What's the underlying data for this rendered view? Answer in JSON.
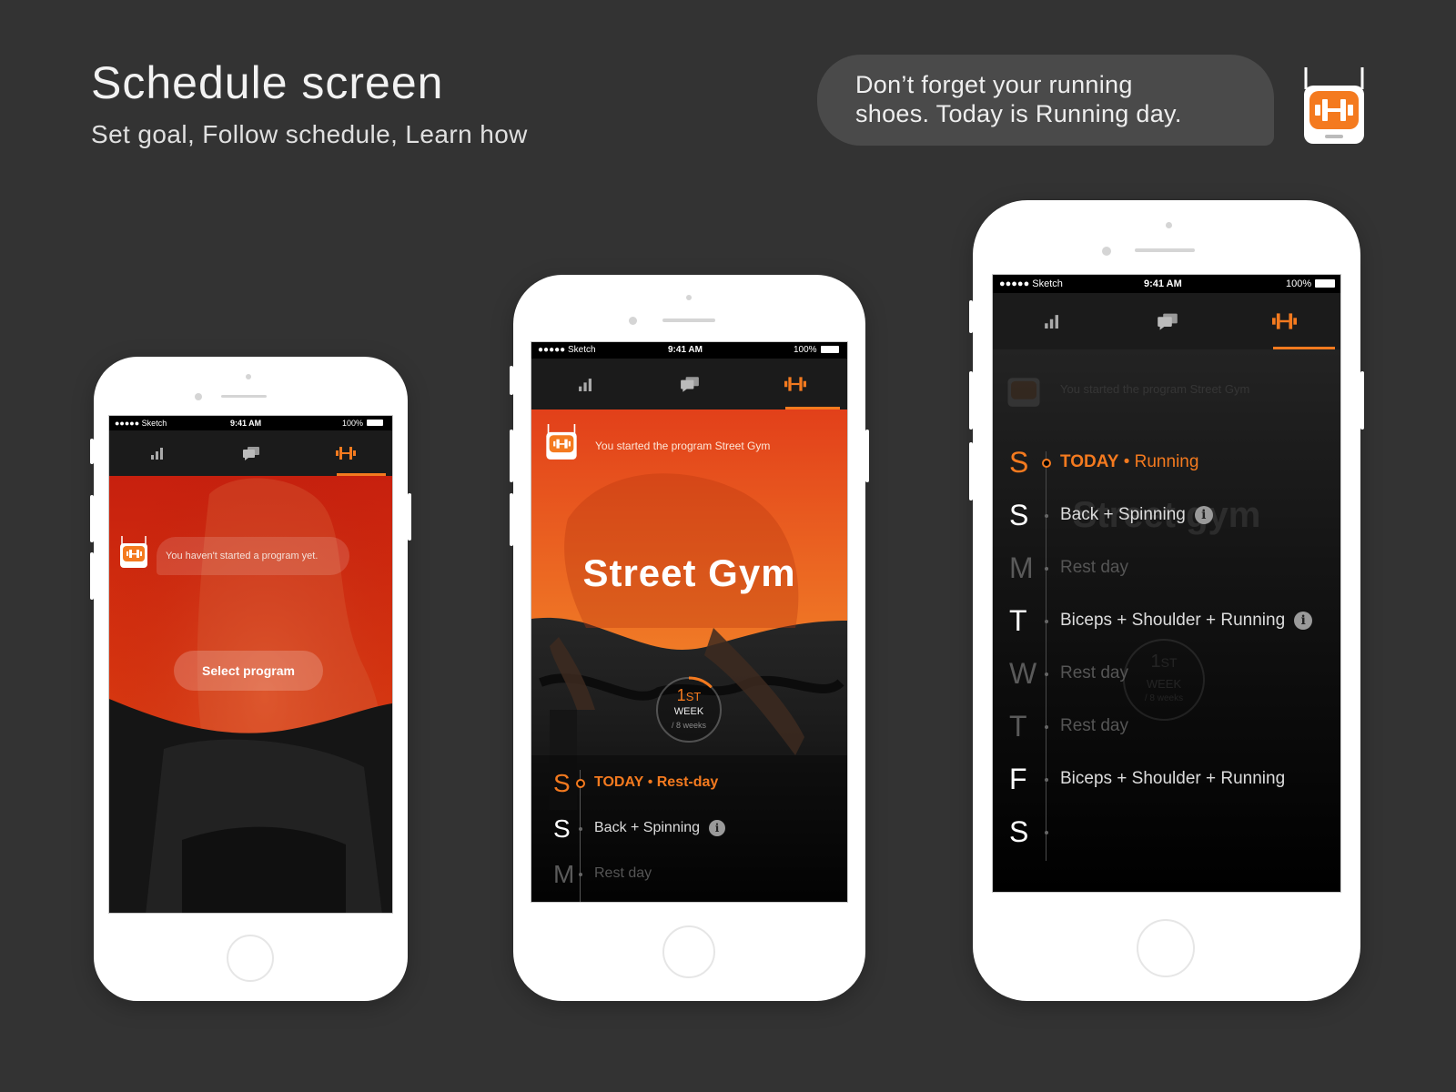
{
  "header": {
    "title": "Schedule screen",
    "subtitle": "Set goal, Follow schedule, Learn how"
  },
  "notification": {
    "line1": "Don’t forget your running",
    "line2": "shoes. Today is Running day."
  },
  "brand_color": "#f47a1f",
  "status_bar": {
    "carrier": "●●●●● Sketch",
    "time": "9:41 AM",
    "battery": "100%"
  },
  "tabs": [
    {
      "icon": "stats-icon"
    },
    {
      "icon": "chat-icon"
    },
    {
      "icon": "dumbbell-icon",
      "active": true
    }
  ],
  "phone1": {
    "message": "You haven't started a program yet.",
    "select_button": "Select program"
  },
  "phone2": {
    "message": "You started the program Street Gym",
    "program_title": "Street Gym",
    "week": {
      "number": "1",
      "suffix": "ST",
      "label": "WEEK",
      "total": "/ 8 weeks",
      "progress": 0.125
    },
    "schedule": [
      {
        "day": "S",
        "today": true,
        "today_label": "TODAY",
        "workout": "Rest-day"
      },
      {
        "day": "S",
        "workout": "Back + Spinning",
        "info": true
      },
      {
        "day": "M",
        "workout": "Rest day",
        "dim": true
      }
    ]
  },
  "phone3": {
    "faded_message": "You started the program Street Gym",
    "faded_title": "Street gym",
    "faded_week": {
      "number": "1",
      "suffix": "ST",
      "label": "WEEK",
      "total": "/ 8 weeks"
    },
    "schedule": [
      {
        "day": "S",
        "today": true,
        "today_label": "TODAY",
        "workout": "Running"
      },
      {
        "day": "S",
        "workout": "Back + Spinning",
        "info": true
      },
      {
        "day": "M",
        "workout": "Rest day",
        "dim": true
      },
      {
        "day": "T",
        "workout": "Biceps + Shoulder + Running",
        "info": true
      },
      {
        "day": "W",
        "workout": "Rest day",
        "dim": true
      },
      {
        "day": "T",
        "workout": "Rest day",
        "dim": true
      },
      {
        "day": "F",
        "workout": "Biceps + Shoulder + Running"
      },
      {
        "day": "S",
        "workout": ""
      }
    ]
  }
}
